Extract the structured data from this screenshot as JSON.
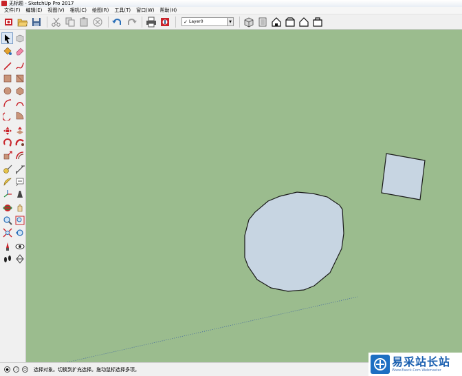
{
  "window": {
    "title": "无标题 - SketchUp Pro 2017",
    "icon": "sketchup-app-icon"
  },
  "menubar": {
    "items": [
      "文件(F)",
      "编辑(E)",
      "视图(V)",
      "相机(C)",
      "绘图(R)",
      "工具(T)",
      "窗口(W)",
      "帮助(H)"
    ]
  },
  "toolbar": {
    "icons": [
      "getting-started-icon",
      "open-icon",
      "save-icon",
      "cut-icon",
      "copy-icon",
      "paste-icon",
      "erase-icon",
      "undo-icon",
      "redo-icon",
      "print-icon",
      "model-info-icon"
    ],
    "layer": {
      "check": "✓",
      "value": "Layer0",
      "arrow": "▼"
    },
    "view_icons": [
      "iso-view-icon",
      "top-view-icon",
      "front-view-icon",
      "right-view-icon",
      "back-view-icon",
      "left-view-icon"
    ]
  },
  "left_tools": [
    [
      "select-icon",
      "make-component-icon"
    ],
    [
      "paint-bucket-icon",
      "eraser-icon"
    ],
    [
      "line-icon",
      "freehand-icon"
    ],
    [
      "rectangle-icon",
      "rotated-rectangle-icon"
    ],
    [
      "circle-icon",
      "polygon-icon"
    ],
    [
      "arc-icon",
      "two-point-arc-icon"
    ],
    [
      "three-point-arc-icon",
      "pie-icon"
    ],
    [
      "move-icon",
      "push-pull-icon"
    ],
    [
      "rotate-icon",
      "follow-me-icon"
    ],
    [
      "scale-icon",
      "offset-icon"
    ],
    [
      "tape-measure-icon",
      "dimension-icon"
    ],
    [
      "protractor-icon",
      "text-icon"
    ],
    [
      "axes-icon",
      "3d-text-icon"
    ],
    [
      "orbit-icon",
      "pan-icon"
    ],
    [
      "zoom-icon",
      "zoom-window-icon"
    ],
    [
      "zoom-extents-icon",
      "previous-view-icon"
    ],
    [
      "position-camera-icon",
      "look-around-icon"
    ],
    [
      "walk-icon",
      "section-plane-icon"
    ]
  ],
  "scene": {
    "background": "#9bbc8e",
    "face_color": "#c7d5e2",
    "edge_color": "#1a1a1a"
  },
  "statusbar": {
    "icons": [
      "geo-location-icon",
      "credits-icon",
      "user-icon"
    ],
    "text": "选择对象。切换到扩充选择。拖动鼠标选择多项。"
  },
  "watermark": {
    "title": "易采站长站",
    "subtitle": "Www.Easck.Com Webmaster"
  }
}
